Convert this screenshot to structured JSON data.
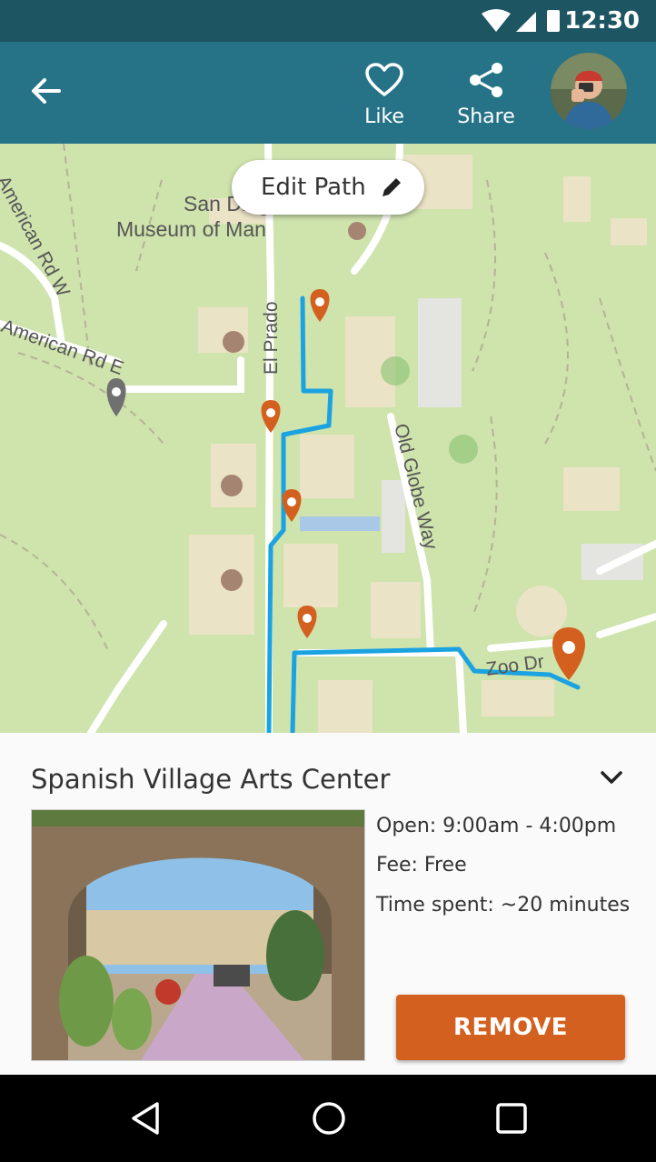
{
  "status_bar": {
    "time": "12:30"
  },
  "app_bar": {
    "back_icon": "arrow-left-icon",
    "like": {
      "icon": "heart-icon",
      "label": "Like"
    },
    "share": {
      "icon": "share-icon",
      "label": "Share"
    },
    "avatar": "user-avatar"
  },
  "map": {
    "edit_path_label": "Edit Path",
    "street_labels": [
      "San Diego",
      "Museum of Man",
      "American Rd W",
      "American Rd E",
      "El Prado",
      "Old Globe Way",
      "Zoo Dr"
    ],
    "route_color": "#1aa3e0",
    "pin_color": "#d4601f"
  },
  "place": {
    "title": "Spanish Village Arts Center",
    "open": "Open: 9:00am - 4:00pm",
    "fee": "Fee: Free",
    "time_spent": "Time spent: ~20 minutes",
    "remove_label": "REMOVE"
  },
  "colors": {
    "status_bar": "#1d5563",
    "app_bar": "#267388",
    "remove_button": "#d4601f"
  }
}
